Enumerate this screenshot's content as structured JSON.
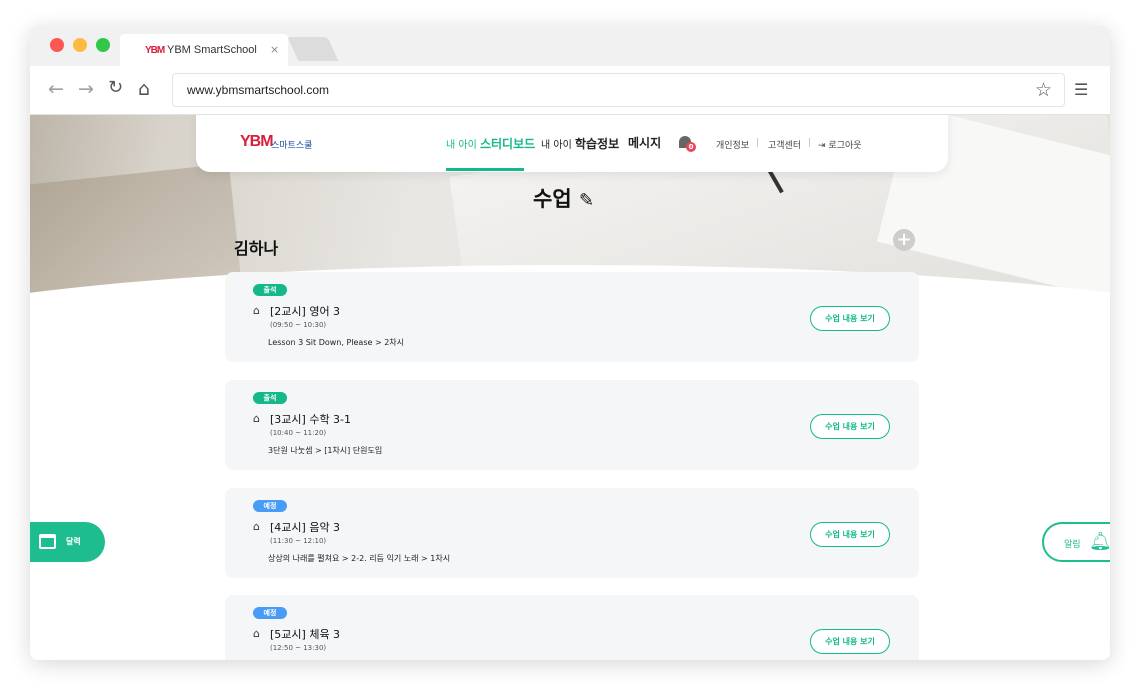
{
  "browser": {
    "tab_title": "YBM SmartSchool",
    "tab_logo": "YBM",
    "tab_close": "×",
    "url": "www.ybmsmartschool.com",
    "icons": [
      "back-arrow-icon",
      "forward-arrow-icon",
      "reload-icon",
      "home-icon",
      "star-icon",
      "hamburger-menu-icon"
    ]
  },
  "header": {
    "logo": "YBM",
    "brand": "스마트스쿨",
    "menu": {
      "dashboard_prefix": "내 아이",
      "dashboard": "스터디보드",
      "info_prefix": "내 아이",
      "info": "학습정보",
      "messages": "메시지"
    },
    "notification_count": "0",
    "util": {
      "profile": "개인정보",
      "sep": "|",
      "support": "고객센터",
      "logout": "로그아웃"
    }
  },
  "page": {
    "title": "수업",
    "student_name": "김하나",
    "add_label": "+"
  },
  "classes": [
    {
      "status": "출석",
      "name": "[2교시] 영어 3",
      "time": "(09:50 ~ 10:30)",
      "lesson": "Lesson 3 Sit Down, Please > 2차시",
      "button": "수업 내용 보기"
    },
    {
      "status": "출석",
      "name": "[3교시] 수학 3-1",
      "time": "(10:40 ~ 11:20)",
      "lesson": "3단원 나눗셈 > [1차시] 단원도입",
      "button": "수업 내용 보기"
    },
    {
      "status": "예정",
      "name": "[4교시] 음악 3",
      "time": "(11:30 ~ 12:10)",
      "lesson": "상상의 나래를 펼쳐요 > 2-2. 리듬 익기 노래 > 1차시",
      "button": "수업 내용 보기"
    },
    {
      "status": "예정",
      "name": "[5교시] 체육 3",
      "time": "(12:50 ~ 13:30)",
      "lesson": "",
      "button": "수업 내용 보기"
    }
  ],
  "floating": {
    "calendar": "달력",
    "alarm": "알림"
  },
  "colors": {
    "accent": "#15b88a",
    "scheduled": "#4a9bf5",
    "brand_red": "#d8203b",
    "brand_blue": "#1d4fa0"
  }
}
